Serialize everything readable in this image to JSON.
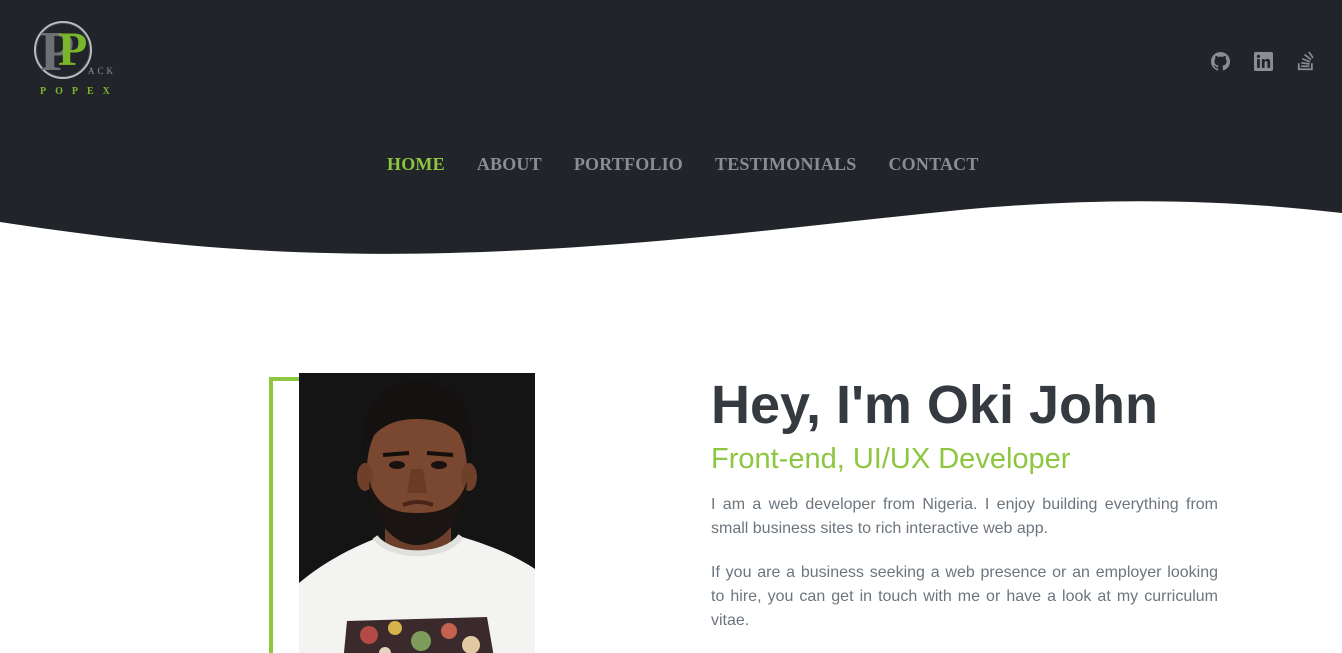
{
  "brand": {
    "logo_alt": "Rack Popex logo",
    "logo_mark": "P",
    "logo_word_top": "ACK",
    "logo_word_bottom": "POPEX"
  },
  "social": [
    {
      "name": "github-icon",
      "label": "GitHub"
    },
    {
      "name": "linkedin-icon",
      "label": "LinkedIn"
    },
    {
      "name": "stackoverflow-icon",
      "label": "Stack Overflow"
    }
  ],
  "nav": {
    "items": [
      {
        "label": "HOME",
        "active": true
      },
      {
        "label": "ABOUT",
        "active": false
      },
      {
        "label": "PORTFOLIO",
        "active": false
      },
      {
        "label": "TESTIMONIALS",
        "active": false
      },
      {
        "label": "CONTACT",
        "active": false
      }
    ]
  },
  "hero": {
    "title": "Hey, I'm Oki John",
    "subtitle": "Front-end, UI/UX Developer",
    "paragraph_1": "I am a web developer from Nigeria. I enjoy building everything from small business sites to rich interactive web app.",
    "paragraph_2": "If you are a business seeking a web presence or an employer looking to hire, you can get in touch with me or have a look at my curriculum vitae.",
    "photo_alt": "Portrait of Oki John"
  },
  "colors": {
    "header_bg": "#212428",
    "accent": "#8dc63f",
    "nav_text": "#8a8d91",
    "heading": "#343a40",
    "body_text": "#6c757d"
  }
}
